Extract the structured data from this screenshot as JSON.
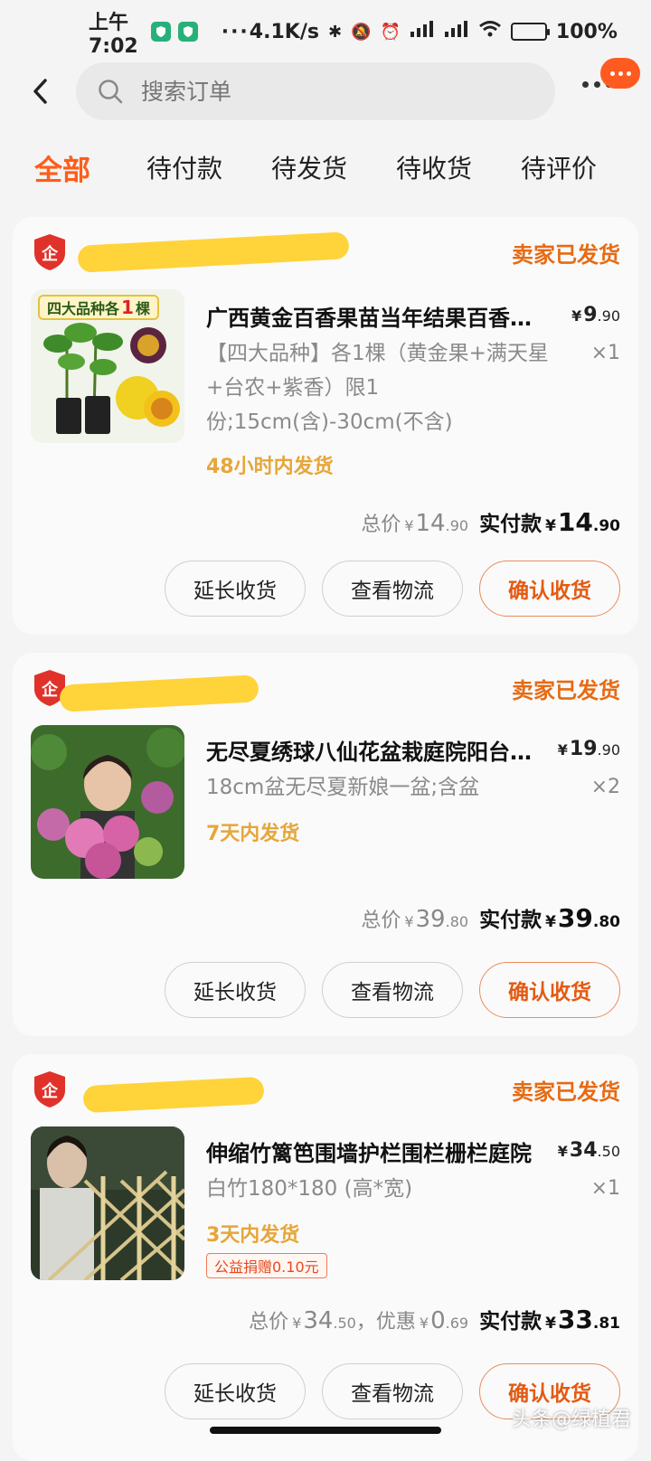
{
  "status_bar": {
    "time": "上午7:02",
    "network_speed": "4.1K/s",
    "battery": "100%",
    "battery_level": 1.0
  },
  "header": {
    "search_placeholder": "搜索订单"
  },
  "tabs": [
    {
      "label": "全部",
      "active": true
    },
    {
      "label": "待付款",
      "active": false
    },
    {
      "label": "待发货",
      "active": false
    },
    {
      "label": "待收货",
      "active": false
    },
    {
      "label": "待评价",
      "active": false
    }
  ],
  "orders": [
    {
      "status": "卖家已发货",
      "image_label_prefix": "四大品种各",
      "image_label_num": "1",
      "image_label_suffix": "棵",
      "title": "广西黄金百香果苗当年结果百香果树苗盆栽",
      "price_int": "9",
      "price_dec": ".90",
      "quantity": "×1",
      "spec": "【四大品种】各1棵（黄金果+满天星+台农+紫香）限1份;15cm(含)-30cm(不含)",
      "shipping": "48小时内发货",
      "total_label": "总价",
      "total_int": "14",
      "total_dec": ".90",
      "paid_label": "实付款",
      "paid_int": "14",
      "paid_dec": ".90",
      "buttons": [
        "延长收货",
        "查看物流",
        "确认收货"
      ]
    },
    {
      "status": "卖家已发货",
      "title": "无尽夏绣球八仙花盆栽庭院阳台花卉",
      "price_int": "19",
      "price_dec": ".90",
      "quantity": "×2",
      "spec": "18cm盆无尽夏新娘一盆;含盆",
      "shipping": "7天内发货",
      "total_label": "总价",
      "total_int": "39",
      "total_dec": ".80",
      "paid_label": "实付款",
      "paid_int": "39",
      "paid_dec": ".80",
      "buttons": [
        "延长收货",
        "查看物流",
        "确认收货"
      ]
    },
    {
      "status": "卖家已发货",
      "title": "伸缩竹篱笆围墙护栏围栏栅栏庭院",
      "price_int": "34",
      "price_dec": ".50",
      "quantity": "×1",
      "spec": "白竹180*180 (高*宽)",
      "shipping": "3天内发货",
      "donation": "公益捐赠0.10元",
      "total_label": "总价",
      "total_int": "34",
      "total_dec": ".50",
      "discount_label": "，优惠",
      "discount_int": "0",
      "discount_dec": ".69",
      "paid_label": "实付款",
      "paid_int": "33",
      "paid_dec": ".81",
      "buttons": [
        "延长收货",
        "查看物流",
        "确认收货"
      ]
    }
  ],
  "currency_symbol": "¥",
  "watermark": "头条@绿植君",
  "colors": {
    "accent": "#ff5d18",
    "status": "#e66b14",
    "shipping": "#e6a63a",
    "shop_badge": "#e0322a"
  }
}
